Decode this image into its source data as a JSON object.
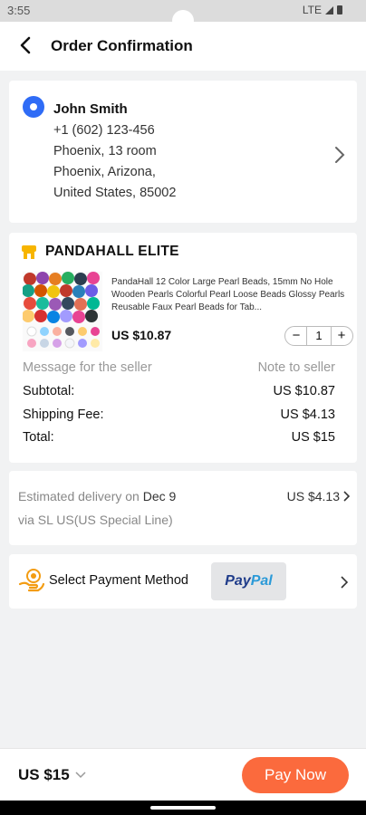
{
  "status_bar": {
    "time": "3:55",
    "network": "LTE"
  },
  "header": {
    "title": "Order Confirmation"
  },
  "address": {
    "name": "John Smith",
    "phone": "+1 (602) 123-456",
    "line1": "Phoenix, 13 room",
    "line2": "Phoenix,  Arizona,",
    "line3": "United States, 85002"
  },
  "order": {
    "shop_name": "PANDAHALL ELITE",
    "product_name": "PandaHall 12 Color Large Pearl Beads, 15mm No Hole Wooden Pearls Colorful Pearl Loose Beads Glossy Pearls Reusable Faux Pearl Beads for Tab...",
    "price": "US $10.87",
    "quantity": "1",
    "message_label": "Message for the seller",
    "message_placeholder": "Note to seller",
    "subtotal_label": "Subtotal:",
    "subtotal_value": "US $10.87",
    "shipping_label": "Shipping Fee:",
    "shipping_value": "US $4.13",
    "total_label": "Total:",
    "total_value": "US $15"
  },
  "delivery": {
    "estimate_label": "Estimated delivery on ",
    "estimate_date": "Dec 9",
    "method": "via SL US(US Special Line)",
    "fee": "US $4.13"
  },
  "payment": {
    "label": "Select Payment Method",
    "paypal_part1": "Pay",
    "paypal_part2": "Pal"
  },
  "footer": {
    "total": "US $15",
    "pay_button": "Pay Now"
  },
  "colors": {
    "accent": "#fb6a3d",
    "pin": "#2f6cf6",
    "shop_icon": "#f7b500"
  }
}
